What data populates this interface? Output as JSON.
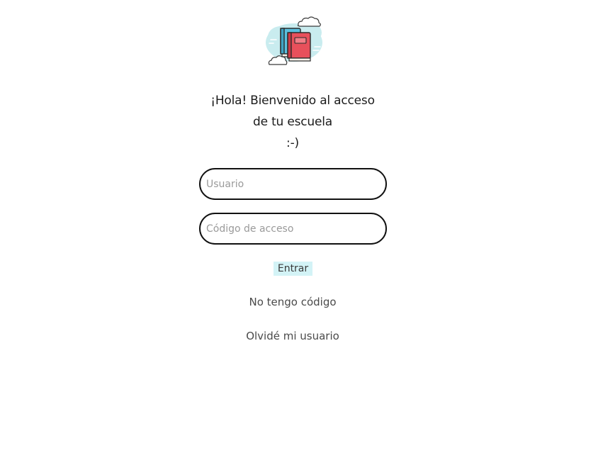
{
  "logo": {
    "icon": "books-icon",
    "colors": {
      "cloud": "#c9ecef",
      "book_blue": "#5bc0de",
      "book_red": "#e8505b"
    }
  },
  "greeting": {
    "line1": "¡Hola! Bienvenido al acceso",
    "line2": "de tu escuela",
    "line3": ":-)"
  },
  "form": {
    "username_placeholder": "Usuario",
    "username_value": "",
    "code_placeholder": "Código de acceso",
    "code_value": "",
    "submit_label": "Entrar"
  },
  "links": {
    "no_code": "No tengo código",
    "forgot_user": "Olvidé mi usuario"
  },
  "colors": {
    "submit_bg": "#d3f3f6",
    "field_border": "#111111"
  }
}
